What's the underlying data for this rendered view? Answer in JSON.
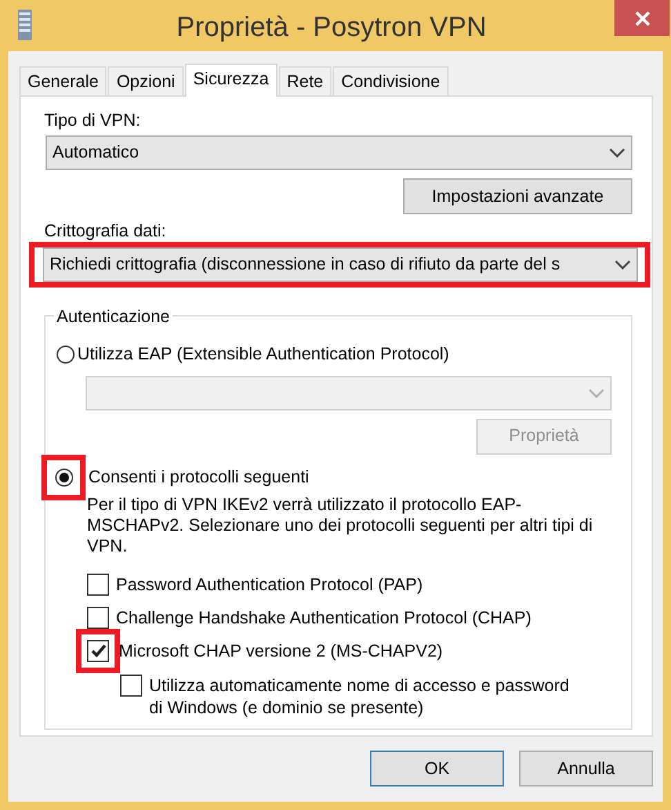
{
  "window": {
    "title": "Proprietà - Posytron VPN"
  },
  "tabs": [
    {
      "label": "Generale",
      "selected": false
    },
    {
      "label": "Opzioni",
      "selected": false
    },
    {
      "label": "Sicurezza",
      "selected": true
    },
    {
      "label": "Rete",
      "selected": false
    },
    {
      "label": "Condivisione",
      "selected": false
    }
  ],
  "vpn_type": {
    "label": "Tipo di VPN:",
    "value": "Automatico"
  },
  "advanced_button": "Impostazioni avanzate",
  "encryption": {
    "label": "Crittografia dati:",
    "value": "Richiedi crittografia (disconnessione in caso di rifiuto da parte del s",
    "highlighted": true
  },
  "authentication": {
    "title": "Autenticazione",
    "options": [
      {
        "label": "Utilizza EAP (Extensible Authentication Protocol)",
        "selected": false,
        "highlighted": false
      },
      {
        "label": "Consenti i protocolli seguenti",
        "selected": true,
        "highlighted": true
      }
    ],
    "eap_select": {
      "disabled": true
    },
    "eap_properties_button": {
      "label": "Proprietà",
      "disabled": true
    },
    "note": "Per il tipo di VPN IKEv2 verrà utilizzato il protocollo EAP-MSCHAPv2. Selezionare uno dei protocolli seguenti per altri tipi di VPN.",
    "protocols": [
      {
        "label": "Password Authentication Protocol (PAP)",
        "checked": false,
        "highlighted": false
      },
      {
        "label": "Challenge Handshake Authentication Protocol (CHAP)",
        "checked": false,
        "highlighted": false
      },
      {
        "label": "Microsoft CHAP versione 2 (MS-CHAPV2)",
        "checked": true,
        "highlighted": true,
        "children": [
          {
            "label": "Utilizza automaticamente nome di accesso e password di Windows (e dominio se presente)",
            "checked": false,
            "highlighted": false
          }
        ]
      }
    ]
  },
  "buttons": [
    {
      "label": "OK",
      "default": true
    },
    {
      "label": "Annulla",
      "default": false
    }
  ]
}
